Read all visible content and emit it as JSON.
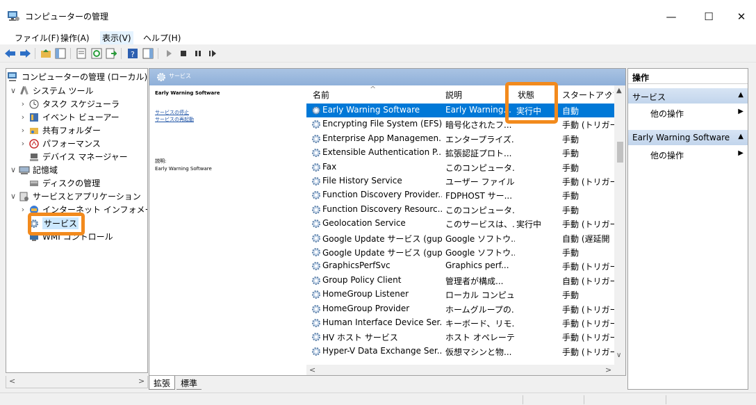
{
  "window": {
    "title": "コンピューターの管理",
    "minimize": "—",
    "maximize": "☐",
    "close": "✕"
  },
  "menu": [
    "ファイル(F)",
    "操作(A)",
    "表示(V)",
    "ヘルプ(H)"
  ],
  "tree": {
    "items": [
      {
        "label": "コンピューターの管理 (ローカル)",
        "indent": 0,
        "exp": "",
        "icon": "computer-management-icon"
      },
      {
        "label": "システム ツール",
        "indent": 1,
        "exp": "∨",
        "icon": "tools-icon"
      },
      {
        "label": "タスク スケジューラ",
        "indent": 2,
        "exp": "›",
        "icon": "clock-icon"
      },
      {
        "label": "イベント ビューアー",
        "indent": 2,
        "exp": "›",
        "icon": "event-viewer-icon"
      },
      {
        "label": "共有フォルダー",
        "indent": 2,
        "exp": "›",
        "icon": "shared-folder-icon"
      },
      {
        "label": "パフォーマンス",
        "indent": 2,
        "exp": "›",
        "icon": "performance-icon"
      },
      {
        "label": "デバイス マネージャー",
        "indent": 2,
        "exp": "",
        "icon": "device-manager-icon"
      },
      {
        "label": "記憶域",
        "indent": 1,
        "exp": "∨",
        "icon": "storage-icon"
      },
      {
        "label": "ディスクの管理",
        "indent": 2,
        "exp": "",
        "icon": "disk-icon"
      },
      {
        "label": "サービスとアプリケーション",
        "indent": 1,
        "exp": "∨",
        "icon": "services-apps-icon"
      },
      {
        "label": "インターネット インフォメーシ",
        "indent": 2,
        "exp": "›",
        "icon": "iis-icon"
      },
      {
        "label": "サービス",
        "indent": 2,
        "exp": "",
        "icon": "gear-icon",
        "selected": true
      },
      {
        "label": "WMI コントロール",
        "indent": 2,
        "exp": "",
        "icon": "wmi-icon"
      }
    ]
  },
  "center": {
    "header_title": "サービス",
    "detail": {
      "name": "Early Warning Software",
      "link_stop": "サービスの停止",
      "link_restart": "サービスの再起動",
      "desc_label": "説明:",
      "desc": "Early Warning Software"
    },
    "columns": {
      "name": "名前",
      "desc": "説明",
      "status": "状態",
      "startup": "スタートアップの"
    },
    "rows": [
      {
        "name": "Early Warning Software",
        "desc": "Early Warning...",
        "status": "実行中",
        "startup": "自動",
        "selected": true
      },
      {
        "name": "Encrypting File System (EFS)",
        "desc": "暗号化されたフ...",
        "status": "",
        "startup": "手動 (トリガー"
      },
      {
        "name": "Enterprise App Managemen...",
        "desc": "エンタープライズ...",
        "status": "",
        "startup": "手動"
      },
      {
        "name": "Extensible Authentication P...",
        "desc": "拡張認証プロト...",
        "status": "",
        "startup": "手動"
      },
      {
        "name": "Fax",
        "desc": "このコンピュータ...",
        "status": "",
        "startup": "手動"
      },
      {
        "name": "File History Service",
        "desc": "ユーザー ファイル...",
        "status": "",
        "startup": "手動 (トリガー"
      },
      {
        "name": "Function Discovery Provider...",
        "desc": "FDPHOST サー...",
        "status": "",
        "startup": "手動"
      },
      {
        "name": "Function Discovery Resourc...",
        "desc": "このコンピュータ...",
        "status": "",
        "startup": "手動"
      },
      {
        "name": "Geolocation Service",
        "desc": "このサービスは、...",
        "status": "実行中",
        "startup": "手動 (トリガー"
      },
      {
        "name": "Google Update サービス (gup...",
        "desc": "Google ソフトウ...",
        "status": "",
        "startup": "自動 (遅延開"
      },
      {
        "name": "Google Update サービス (gup...",
        "desc": "Google ソフトウ...",
        "status": "",
        "startup": "手動"
      },
      {
        "name": "GraphicsPerfSvc",
        "desc": "Graphics perf...",
        "status": "",
        "startup": "手動 (トリガー"
      },
      {
        "name": "Group Policy Client",
        "desc": "管理者が構成...",
        "status": "",
        "startup": "自動 (トリガー"
      },
      {
        "name": "HomeGroup Listener",
        "desc": "ローカル コンピュ...",
        "status": "",
        "startup": "手動"
      },
      {
        "name": "HomeGroup Provider",
        "desc": "ホームグループの...",
        "status": "",
        "startup": "手動 (トリガー"
      },
      {
        "name": "Human Interface Device Ser...",
        "desc": "キーボード、リモ...",
        "status": "",
        "startup": "手動 (トリガー"
      },
      {
        "name": "HV ホスト サービス",
        "desc": "ホスト オペレーテ...",
        "status": "",
        "startup": "手動 (トリガー"
      },
      {
        "name": "Hyper-V Data Exchange Ser...",
        "desc": "仮想マシンと物...",
        "status": "",
        "startup": "手動 (トリガー"
      }
    ],
    "tabs": [
      "拡張",
      "標準"
    ]
  },
  "actions": {
    "title": "操作",
    "sections": [
      {
        "label": "サービス",
        "item": "他の操作"
      },
      {
        "label": "Early Warning Software",
        "item": "他の操作"
      }
    ]
  },
  "colors": {
    "highlight": "#f28a1d",
    "selection": "#0078d7",
    "header_blue": "#8fb0d9"
  }
}
